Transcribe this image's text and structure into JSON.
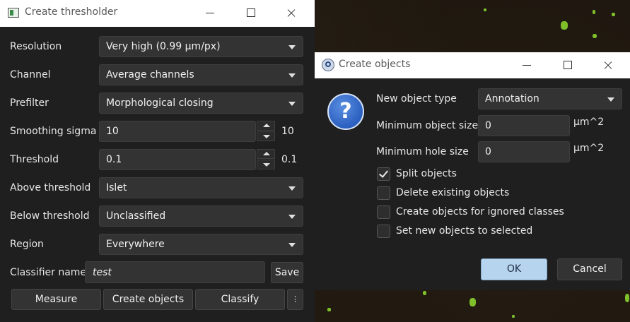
{
  "thresholder": {
    "title": "Create thresholder",
    "fields": {
      "resolution": {
        "label": "Resolution",
        "value": "Very high (0.99 µm/px)"
      },
      "channel": {
        "label": "Channel",
        "value": "Average channels"
      },
      "prefilter": {
        "label": "Prefilter",
        "value": "Morphological closing"
      },
      "smoothing_sigma": {
        "label": "Smoothing sigma",
        "value": "10",
        "display": "10"
      },
      "threshold": {
        "label": "Threshold",
        "value": "0.1",
        "display": "0.1"
      },
      "above_threshold": {
        "label": "Above threshold",
        "value": "Islet"
      },
      "below_threshold": {
        "label": "Below threshold",
        "value": "Unclassified"
      },
      "region": {
        "label": "Region",
        "value": "Everywhere"
      },
      "classifier_name": {
        "label": "Classifier name",
        "value": "test"
      }
    },
    "buttons": {
      "save": "Save",
      "measure": "Measure",
      "create_objects": "Create objects",
      "classify": "Classify",
      "more": "⋮"
    }
  },
  "create_objects": {
    "title": "Create objects",
    "fields": {
      "new_object_type": {
        "label": "New object type",
        "value": "Annotation"
      },
      "min_object_size": {
        "label": "Minimum object size",
        "value": "0",
        "unit": "µm^2"
      },
      "min_hole_size": {
        "label": "Minimum hole size",
        "value": "0",
        "unit": "µm^2"
      }
    },
    "checkboxes": {
      "split_objects": {
        "label": "Split objects",
        "checked": true
      },
      "delete_existing": {
        "label": "Delete existing objects",
        "checked": false
      },
      "ignored_classes": {
        "label": "Create objects for ignored classes",
        "checked": false
      },
      "set_selected": {
        "label": "Set new objects to selected",
        "checked": false
      }
    },
    "buttons": {
      "ok": "OK",
      "cancel": "Cancel"
    },
    "question_glyph": "?"
  },
  "colors": {
    "accent_ok": "#b7d4ee",
    "question_icon": "#2b5fc0",
    "speck": "#7fbf2a"
  }
}
